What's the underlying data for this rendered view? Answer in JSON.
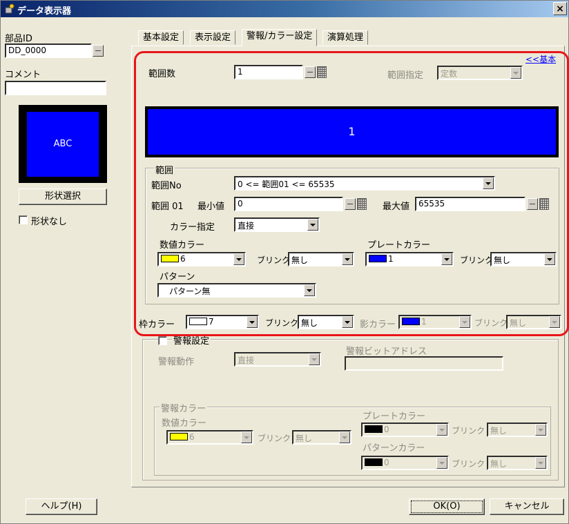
{
  "window": {
    "title": "データ表示器",
    "close": "×"
  },
  "left": {
    "part_id_label": "部品ID",
    "part_id_value": "DD_0000",
    "comment_label": "コメント",
    "comment_value": "",
    "preview_text": "ABC",
    "shape_select_button": "形状選択",
    "no_shape_label": "形状なし"
  },
  "tabs": [
    "基本設定",
    "表示設定",
    "警報/カラー設定",
    "演算処理"
  ],
  "back_link": "<<基本",
  "range_count": {
    "label": "範囲数",
    "value": "1"
  },
  "range_spec": {
    "label": "範囲指定",
    "value": "定数"
  },
  "preview_value": "1",
  "range_group": {
    "title": "範囲",
    "range_no_label": "範囲No",
    "range_no_value": "0 <= 範囲01 <= 65535",
    "range_label": "範囲 01",
    "min_label": "最小値",
    "min_value": "0",
    "max_label": "最大値",
    "max_value": "65535",
    "color_spec_label": "カラー指定",
    "color_spec_value": "直接",
    "value_color_label": "数値カラー",
    "value_color_value": "6",
    "value_color_hex": "#ffff00",
    "blink_label": "ブリンク",
    "value_blink_value": "無し",
    "plate_color_label": "プレートカラー",
    "plate_color_value": "1",
    "plate_color_hex": "#0000ff",
    "plate_blink_value": "無し",
    "pattern_label": "パターン",
    "pattern_value": "パターン無"
  },
  "frame": {
    "frame_color_label": "枠カラー",
    "frame_color_value": "7",
    "frame_color_hex": "#ffffff",
    "blink_label": "ブリンク",
    "frame_blink_value": "無し",
    "shadow_color_label": "影カラー",
    "shadow_color_value": "1",
    "shadow_color_hex": "#0000ff",
    "shadow_blink_value": "無し"
  },
  "alarm": {
    "enable_label": "警報設定",
    "action_label": "警報動作",
    "action_value": "直接",
    "bit_address_label": "警報ビットアドレス",
    "bit_address_value": "",
    "color_group_title": "警報カラー",
    "value_color_label": "数値カラー",
    "value_color_value": "6",
    "value_color_hex": "#ffff00",
    "blink_label": "ブリンク",
    "value_blink_value": "無し",
    "plate_color_label": "プレートカラー",
    "plate_color_value": "0",
    "plate_color_hex": "#000000",
    "plate_blink_value": "無し",
    "pattern_color_label": "パターンカラー",
    "pattern_color_value": "0",
    "pattern_color_hex": "#000000",
    "pattern_blink_value": "無し"
  },
  "footer": {
    "help": "ヘルプ(H)",
    "ok": "OK(O)",
    "cancel": "キャンセル"
  }
}
